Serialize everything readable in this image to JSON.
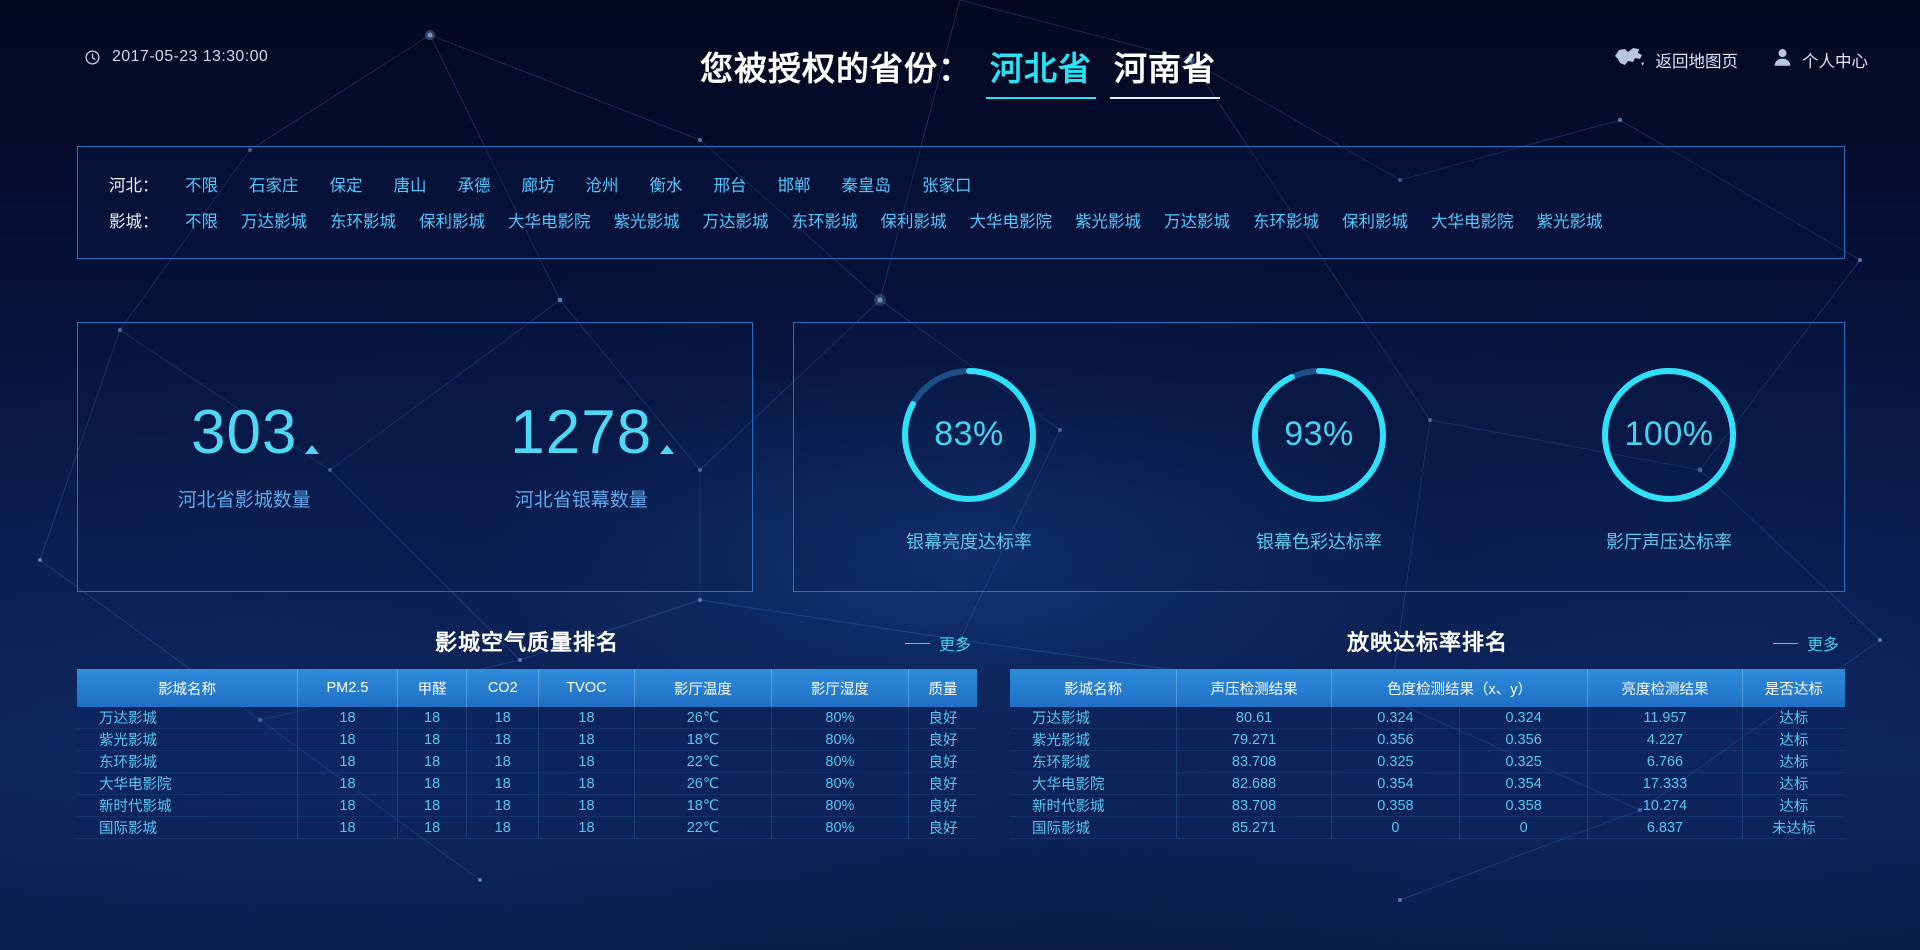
{
  "header": {
    "clock_icon": "clock-icon",
    "datetime": "2017-05-23  13:30:00",
    "title_prefix": "您被授权的省份：",
    "province_active": "河北省",
    "province_idle": "河南省",
    "map_icon": "china-map-icon",
    "map_label": "返回地图页",
    "user_icon": "user-icon",
    "user_label": "个人中心"
  },
  "filter": {
    "city_label": "河北：",
    "cities": [
      "不限",
      "石家庄",
      "保定",
      "唐山",
      "承德",
      "廊坊",
      "沧州",
      "衡水",
      "邢台",
      "邯郸",
      "秦皇岛",
      "张家口"
    ],
    "cinema_label": "影城：",
    "cinemas": [
      "不限",
      "万达影城",
      "东环影城",
      "保利影城",
      "大华电影院",
      "紫光影城",
      "万达影城",
      "东环影城",
      "保利影城",
      "大华电影院",
      "紫光影城",
      "万达影城",
      "东环影城",
      "保利影城",
      "大华电影院",
      "紫光影城"
    ]
  },
  "stats": [
    {
      "value": "303",
      "caption": "河北省影城数量"
    },
    {
      "value": "1278",
      "caption": "河北省银幕数量"
    }
  ],
  "gauges": [
    {
      "value": "83%",
      "percent": 83,
      "caption": "银幕亮度达标率"
    },
    {
      "value": "93%",
      "percent": 93,
      "caption": "银幕色彩达标率"
    },
    {
      "value": "100%",
      "percent": 100,
      "caption": "影厅声压达标率"
    }
  ],
  "air_table": {
    "title": "影城空气质量排名",
    "more": "更多",
    "columns": [
      "影城名称",
      "PM2.5",
      "甲醛",
      "CO2",
      "TVOC",
      "影厅温度",
      "影厅湿度",
      "质量"
    ],
    "rows": [
      [
        "万达影城",
        "18",
        "18",
        "18",
        "18",
        "26℃",
        "80%",
        "良好"
      ],
      [
        "紫光影城",
        "18",
        "18",
        "18",
        "18",
        "18℃",
        "80%",
        "良好"
      ],
      [
        "东环影城",
        "18",
        "18",
        "18",
        "18",
        "22℃",
        "80%",
        "良好"
      ],
      [
        "大华电影院",
        "18",
        "18",
        "18",
        "18",
        "26℃",
        "80%",
        "良好"
      ],
      [
        "新时代影城",
        "18",
        "18",
        "18",
        "18",
        "18℃",
        "80%",
        "良好"
      ],
      [
        "国际影城",
        "18",
        "18",
        "18",
        "18",
        "22℃",
        "80%",
        "良好"
      ]
    ]
  },
  "screen_table": {
    "title": "放映达标率排名",
    "more": "更多",
    "columns": [
      "影城名称",
      "声压检测结果",
      "色度检测结果（x、y）",
      "",
      "亮度检测结果",
      "是否达标"
    ],
    "rows": [
      [
        "万达影城",
        "80.61",
        "0.324",
        "0.324",
        "11.957",
        "达标"
      ],
      [
        "紫光影城",
        "79.271",
        "0.356",
        "0.356",
        "4.227",
        "达标"
      ],
      [
        "东环影城",
        "83.708",
        "0.325",
        "0.325",
        "6.766",
        "达标"
      ],
      [
        "大华电影院",
        "82.688",
        "0.354",
        "0.354",
        "17.333",
        "达标"
      ],
      [
        "新时代影城",
        "83.708",
        "0.358",
        "0.358",
        "10.274",
        "达标"
      ],
      [
        "国际影城",
        "85.271",
        "0",
        "0",
        "6.837",
        "未达标"
      ]
    ]
  },
  "colors": {
    "accent_cyan": "#27e3f5",
    "link_blue": "#4ec8ff",
    "header_blue": "#2f8ddc",
    "panel_border": "#2a6fc0",
    "bg_deep": "#050a28"
  }
}
